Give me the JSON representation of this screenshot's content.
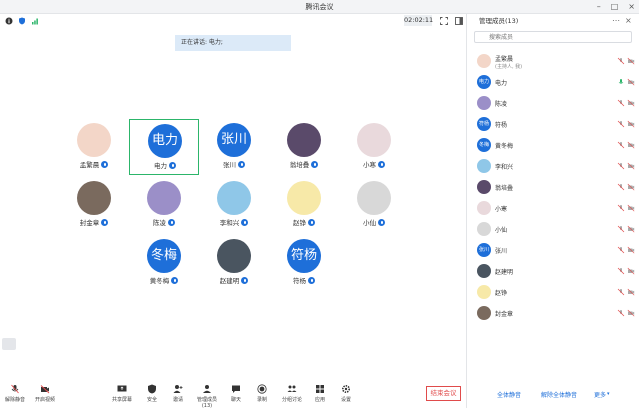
{
  "window": {
    "title": "腾讯会议"
  },
  "toolbar": {
    "timer": "02:02:11"
  },
  "speaking": {
    "label": "正在讲话: 电力;"
  },
  "participants": [
    {
      "name": "孟繁晨",
      "avatar_text": "",
      "avatar_color": "#f3d6c8"
    },
    {
      "name": "电力",
      "avatar_text": "电力",
      "avatar_color": "#1e6fd9"
    },
    {
      "name": "张川",
      "avatar_text": "张川",
      "avatar_color": "#1e6fd9"
    },
    {
      "name": "翁培叠",
      "avatar_text": "",
      "avatar_color": "#5a4a6a"
    },
    {
      "name": "小寒",
      "avatar_text": "",
      "avatar_color": "#e9d9dc"
    },
    {
      "name": "封金章",
      "avatar_text": "",
      "avatar_color": "#7a6a5e"
    },
    {
      "name": "陈凌",
      "avatar_text": "",
      "avatar_color": "#9b8fc8"
    },
    {
      "name": "李和兴",
      "avatar_text": "",
      "avatar_color": "#8fc7e8"
    },
    {
      "name": "赵铮",
      "avatar_text": "",
      "avatar_color": "#f7e9a8"
    },
    {
      "name": "小仙",
      "avatar_text": "",
      "avatar_color": "#d8d8d8"
    },
    {
      "name": "黄冬梅",
      "avatar_text": "冬梅",
      "avatar_color": "#1e6fd9"
    },
    {
      "name": "赵建明",
      "avatar_text": "",
      "avatar_color": "#4a5560"
    },
    {
      "name": "符杨",
      "avatar_text": "符杨",
      "avatar_color": "#1e6fd9"
    }
  ],
  "bottombar": {
    "mute": "解除静音",
    "video": "开启视频",
    "share": "共享屏幕",
    "security": "安全",
    "invite": "邀请",
    "manage": "管理成员(13)",
    "chat": "聊天",
    "record": "录制",
    "breakout": "分组讨论",
    "apps": "应用",
    "settings": "设置",
    "end": "结束会议"
  },
  "panel": {
    "title": "管理成员(13)",
    "search_placeholder": "搜索成员",
    "members": [
      {
        "name": "孟繁晨",
        "sub": "(主持人, 我)",
        "avatar_text": "",
        "avatar_color": "#f3d6c8"
      },
      {
        "name": "电力",
        "avatar_text": "电力",
        "avatar_color": "#1e6fd9"
      },
      {
        "name": "陈凌",
        "avatar_text": "",
        "avatar_color": "#9b8fc8"
      },
      {
        "name": "符杨",
        "avatar_text": "符杨",
        "avatar_color": "#1e6fd9"
      },
      {
        "name": "黄冬梅",
        "avatar_text": "冬梅",
        "avatar_color": "#1e6fd9"
      },
      {
        "name": "李和兴",
        "avatar_text": "",
        "avatar_color": "#8fc7e8"
      },
      {
        "name": "翁培叠",
        "avatar_text": "",
        "avatar_color": "#5a4a6a"
      },
      {
        "name": "小寒",
        "avatar_text": "",
        "avatar_color": "#e9d9dc"
      },
      {
        "name": "小仙",
        "avatar_text": "",
        "avatar_color": "#d8d8d8"
      },
      {
        "name": "张川",
        "avatar_text": "张川",
        "avatar_color": "#1e6fd9"
      },
      {
        "name": "赵建明",
        "avatar_text": "",
        "avatar_color": "#4a5560"
      },
      {
        "name": "赵铮",
        "avatar_text": "",
        "avatar_color": "#f7e9a8"
      },
      {
        "name": "封金章",
        "avatar_text": "",
        "avatar_color": "#7a6a5e"
      }
    ],
    "footer": {
      "mute_all": "全体静音",
      "unmute_all": "解除全体静音",
      "more": "更多"
    }
  },
  "colors": {
    "accent": "#1e6fd9",
    "active_border": "#2cb56a",
    "danger": "#e04b4b",
    "speaking_bg": "#dceaf8"
  }
}
